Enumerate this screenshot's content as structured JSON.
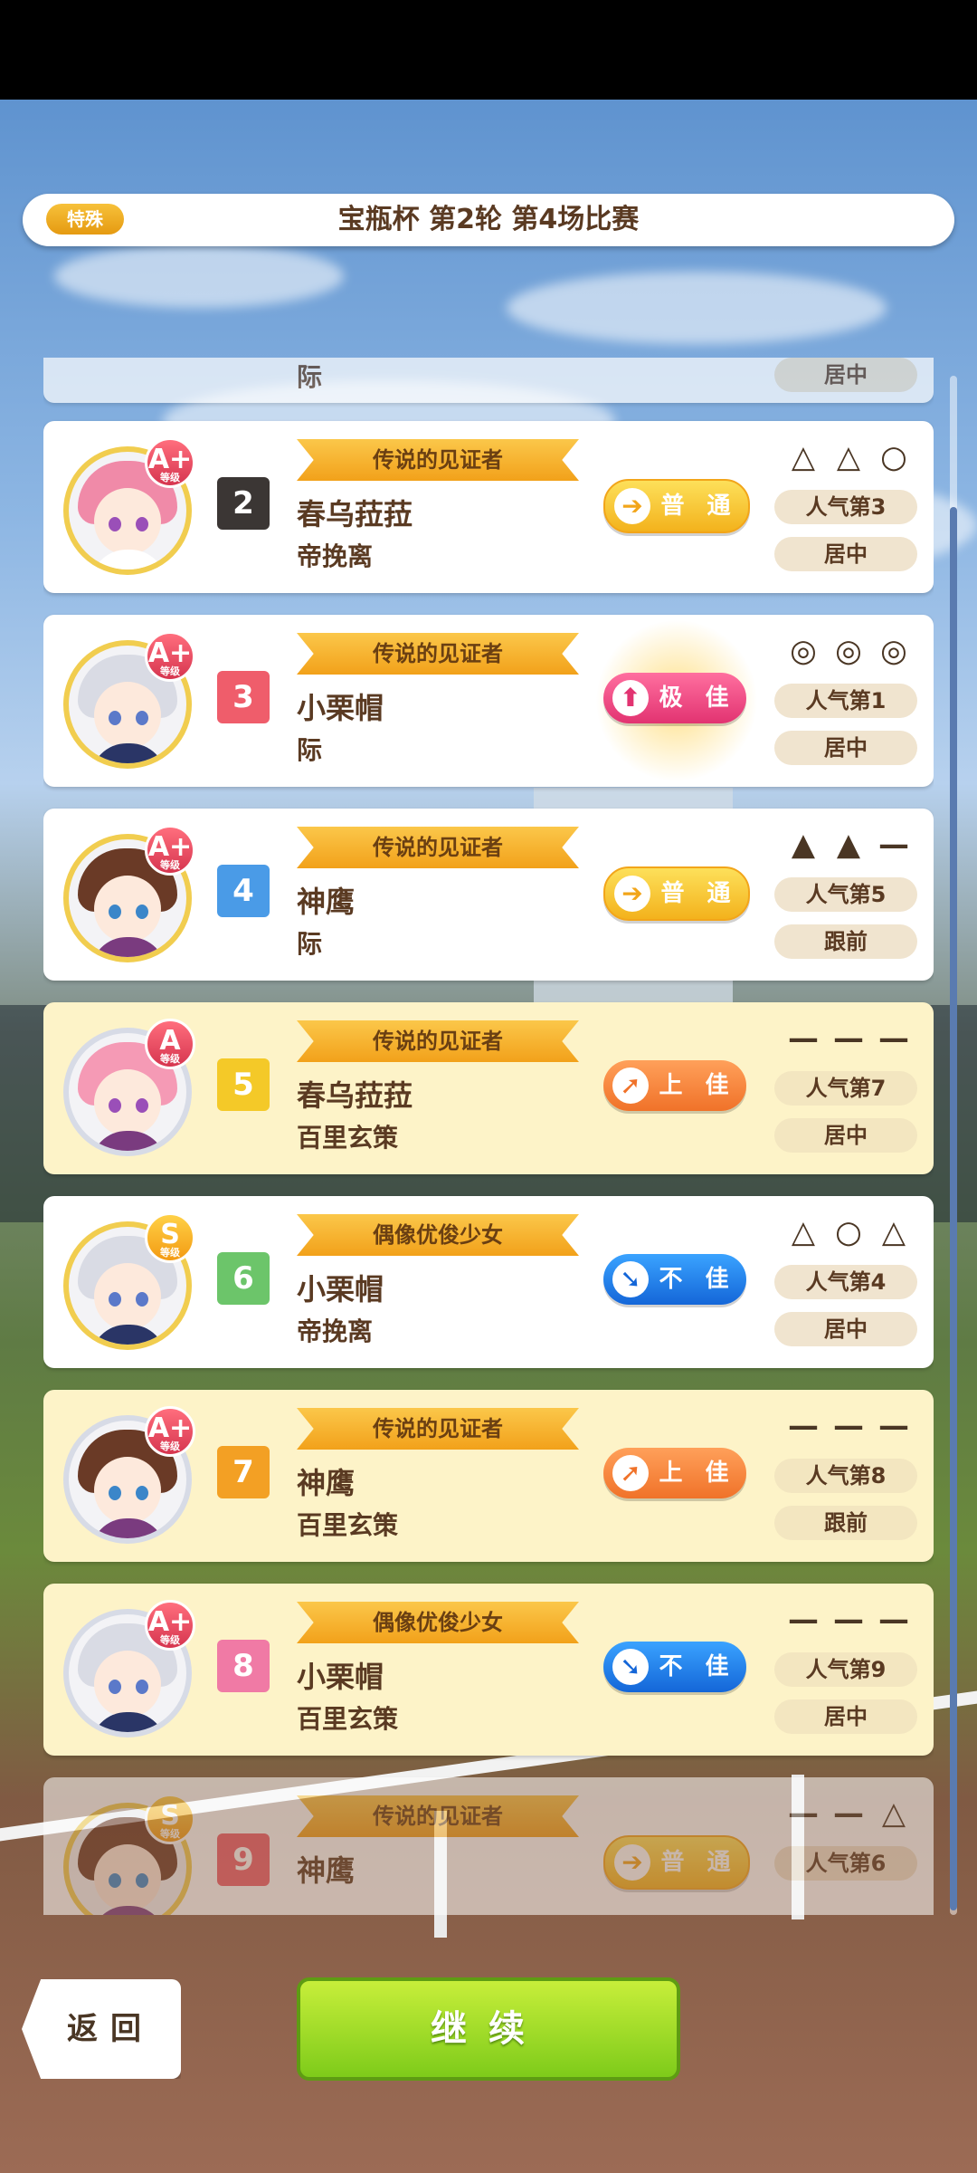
{
  "header": {
    "tag": "特殊",
    "title": "宝瓶杯  第2轮  第4场比赛"
  },
  "entries": [
    {
      "num": "2",
      "num_color": "#3b3634",
      "title": "传说的见证者",
      "name": "春乌菈菈",
      "trainer": "帝挽离",
      "grade": "A+",
      "grade_label": "等级",
      "cond": "普 通",
      "cond_icon": "➔",
      "marks": [
        "△",
        "△",
        "○"
      ],
      "popularity": "人气第3",
      "strategy": "居中"
    },
    {
      "num": "3",
      "num_color": "#ef5d6b",
      "title": "传说的见证者",
      "name": "小栗帽",
      "trainer": "际",
      "grade": "A+",
      "grade_label": "等级",
      "cond": "极 佳",
      "cond_icon": "⬆",
      "marks": [
        "◎",
        "◎",
        "◎"
      ],
      "popularity": "人气第1",
      "strategy": "居中"
    },
    {
      "num": "4",
      "num_color": "#4a9be7",
      "title": "传说的见证者",
      "name": "神鹰",
      "trainer": "际",
      "grade": "A+",
      "grade_label": "等级",
      "cond": "普 通",
      "cond_icon": "➔",
      "marks": [
        "▲",
        "▲",
        "—"
      ],
      "popularity": "人气第5",
      "strategy": "跟前"
    },
    {
      "num": "5",
      "num_color": "#f4c928",
      "title": "传说的见证者",
      "name": "春乌菈菈",
      "trainer": "百里玄策",
      "grade": "A",
      "grade_label": "等级",
      "cond": "上 佳",
      "cond_icon": "➚",
      "marks": [
        "—",
        "—",
        "—"
      ],
      "popularity": "人气第7",
      "strategy": "居中"
    },
    {
      "num": "6",
      "num_color": "#6cc56a",
      "title": "偶像优俊少女",
      "name": "小栗帽",
      "trainer": "帝挽离",
      "grade": "S",
      "grade_label": "等级",
      "cond": "不 佳",
      "cond_icon": "➘",
      "marks": [
        "△",
        "○",
        "△"
      ],
      "popularity": "人气第4",
      "strategy": "居中"
    },
    {
      "num": "7",
      "num_color": "#f3a024",
      "title": "传说的见证者",
      "name": "神鹰",
      "trainer": "百里玄策",
      "grade": "A+",
      "grade_label": "等级",
      "cond": "上 佳",
      "cond_icon": "➚",
      "marks": [
        "—",
        "—",
        "—"
      ],
      "popularity": "人气第8",
      "strategy": "跟前"
    },
    {
      "num": "8",
      "num_color": "#f07aa5",
      "title": "偶像优俊少女",
      "name": "小栗帽",
      "trainer": "百里玄策",
      "grade": "A+",
      "grade_label": "等级",
      "cond": "不 佳",
      "cond_icon": "➘",
      "marks": [
        "—",
        "—",
        "—"
      ],
      "popularity": "人气第9",
      "strategy": "居中"
    },
    {
      "num": "9",
      "num_color": "#ef5d6b",
      "title": "传说的见证者",
      "name": "神鹰",
      "trainer": "",
      "grade": "S",
      "grade_label": "等级",
      "cond": "普 通",
      "cond_icon": "➔",
      "marks": [
        "—",
        "—",
        "△"
      ],
      "popularity": "人气第6",
      "strategy": ""
    }
  ],
  "partial_top": {
    "trainer": "际",
    "strategy": "居中"
  },
  "footer": {
    "back": "返回",
    "continue": "继续"
  }
}
